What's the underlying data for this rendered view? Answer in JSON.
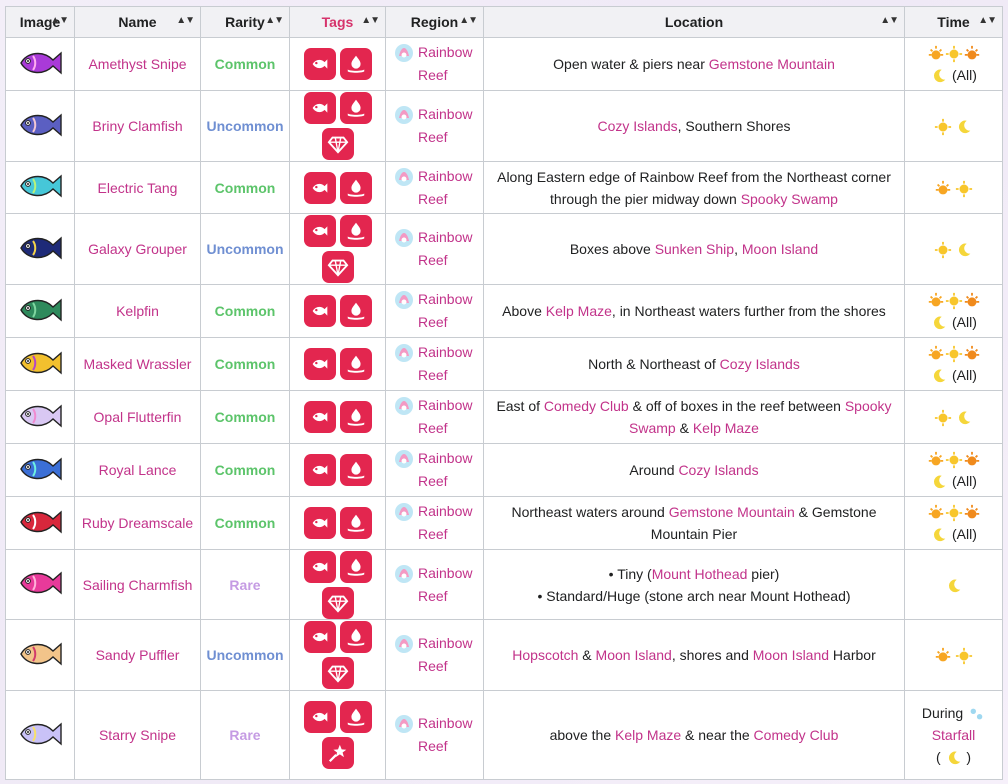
{
  "headers": {
    "image": "Image",
    "name": "Name",
    "rarity": "Rarity",
    "tags": "Tags",
    "region": "Region",
    "location": "Location",
    "time": "Time"
  },
  "rows": [
    {
      "name": "Amethyst Snipe",
      "rarity": "Common",
      "rarity_class": "common",
      "tags": [
        "fish-tag",
        "water-tag"
      ],
      "region": "Rainbow Reef",
      "location_parts": [
        {
          "t": "Open water & piers near "
        },
        {
          "t": "Gemstone Mountain",
          "link": true
        }
      ],
      "time_icons": [
        "sunrise",
        "sun",
        "sunset",
        "moon"
      ],
      "time_text": "(All)",
      "fish_color": "#a93ad8",
      "fish_accent": "#ffb0f0"
    },
    {
      "name": "Briny Clamfish",
      "rarity": "Uncommon",
      "rarity_class": "uncommon",
      "tags": [
        "fish-tag",
        "water-tag",
        "gem-tag"
      ],
      "region": "Rainbow Reef",
      "location_parts": [
        {
          "t": "Cozy Islands",
          "link": true
        },
        {
          "t": ", Southern Shores"
        }
      ],
      "time_icons": [
        "sun",
        "moon"
      ],
      "time_text": "",
      "fish_color": "#5b5fc2",
      "fish_accent": "#f2c7d4"
    },
    {
      "name": "Electric Tang",
      "rarity": "Common",
      "rarity_class": "common",
      "tags": [
        "fish-tag",
        "water-tag"
      ],
      "region": "Rainbow Reef",
      "location_parts": [
        {
          "t": "Along Eastern edge of Rainbow Reef from the Northeast corner through the pier midway down "
        },
        {
          "t": "Spooky Swamp",
          "link": true
        }
      ],
      "time_icons": [
        "sunrise",
        "sun"
      ],
      "time_text": "",
      "fish_color": "#46c7d8",
      "fish_accent": "#b8f27a"
    },
    {
      "name": "Galaxy Grouper",
      "rarity": "Uncommon",
      "rarity_class": "uncommon",
      "tags": [
        "fish-tag",
        "water-tag",
        "gem-tag"
      ],
      "region": "Rainbow Reef",
      "location_parts": [
        {
          "t": "Boxes above "
        },
        {
          "t": "Sunken Ship",
          "link": true
        },
        {
          "t": ", "
        },
        {
          "t": "Moon Island",
          "link": true
        }
      ],
      "time_icons": [
        "sun",
        "moon"
      ],
      "time_text": "",
      "fish_color": "#1e2a78",
      "fish_accent": "#f5d34a"
    },
    {
      "name": "Kelpfin",
      "rarity": "Common",
      "rarity_class": "common",
      "tags": [
        "fish-tag",
        "water-tag"
      ],
      "region": "Rainbow Reef",
      "location_parts": [
        {
          "t": "Above "
        },
        {
          "t": "Kelp Maze",
          "link": true
        },
        {
          "t": ", in Northeast waters further from the shores"
        }
      ],
      "time_icons": [
        "sunrise",
        "sun",
        "sunset",
        "moon"
      ],
      "time_text": "(All)",
      "fish_color": "#2e8a5c",
      "fish_accent": "#7fd6a0"
    },
    {
      "name": "Masked Wrassler",
      "rarity": "Common",
      "rarity_class": "common",
      "tags": [
        "fish-tag",
        "water-tag"
      ],
      "region": "Rainbow Reef",
      "location_parts": [
        {
          "t": "North & Northeast of "
        },
        {
          "t": "Cozy Islands",
          "link": true
        }
      ],
      "time_icons": [
        "sunrise",
        "sun",
        "sunset",
        "moon"
      ],
      "time_text": "(All)",
      "fish_color": "#f2c02e",
      "fish_accent": "#b545c9"
    },
    {
      "name": "Opal Flutterfin",
      "rarity": "Common",
      "rarity_class": "common",
      "tags": [
        "fish-tag",
        "water-tag"
      ],
      "region": "Rainbow Reef",
      "location_parts": [
        {
          "t": "East of "
        },
        {
          "t": "Comedy Club",
          "link": true
        },
        {
          "t": " & off of boxes in the reef between "
        },
        {
          "t": "Spooky Swamp",
          "link": true
        },
        {
          "t": " & "
        },
        {
          "t": "Kelp Maze",
          "link": true
        }
      ],
      "time_icons": [
        "sun",
        "moon"
      ],
      "time_text": "",
      "fish_color": "#d9c8f3",
      "fish_accent": "#f08ad0"
    },
    {
      "name": "Royal Lance",
      "rarity": "Common",
      "rarity_class": "common",
      "tags": [
        "fish-tag",
        "water-tag"
      ],
      "region": "Rainbow Reef",
      "location_parts": [
        {
          "t": "Around "
        },
        {
          "t": "Cozy Islands",
          "link": true
        }
      ],
      "time_icons": [
        "sunrise",
        "sun",
        "sunset",
        "moon"
      ],
      "time_text": "(All)",
      "fish_color": "#3b6fd6",
      "fish_accent": "#6ef0e0"
    },
    {
      "name": "Ruby Dreamscale",
      "rarity": "Common",
      "rarity_class": "common",
      "tags": [
        "fish-tag",
        "water-tag"
      ],
      "region": "Rainbow Reef",
      "location_parts": [
        {
          "t": "Northeast waters around "
        },
        {
          "t": "Gemstone Mountain",
          "link": true
        },
        {
          "t": " & Gemstone Mountain Pier"
        }
      ],
      "time_icons": [
        "sunrise",
        "sun",
        "sunset",
        "moon"
      ],
      "time_text": "(All)",
      "fish_color": "#d8273c",
      "fish_accent": "#ffffff"
    },
    {
      "name": "Sailing Charmfish",
      "rarity": "Rare",
      "rarity_class": "rare",
      "tags": [
        "fish-tag",
        "water-tag",
        "gem-tag"
      ],
      "region": "Rainbow Reef",
      "location_lines": [
        [
          {
            "t": "• Tiny ("
          },
          {
            "t": "Mount Hothead",
            "link": true
          },
          {
            "t": " pier)"
          }
        ],
        [
          {
            "t": "• Standard/Huge (stone arch near Mount Hothead)"
          }
        ]
      ],
      "time_icons": [
        "moon"
      ],
      "time_text": "",
      "fish_color": "#e83a9a",
      "fish_accent": "#ffb3d9"
    },
    {
      "name": "Sandy Puffler",
      "rarity": "Uncommon",
      "rarity_class": "uncommon",
      "tags": [
        "fish-tag",
        "water-tag",
        "gem-tag"
      ],
      "region": "Rainbow Reef",
      "location_parts": [
        {
          "t": "Hopscotch",
          "link": true
        },
        {
          "t": " & "
        },
        {
          "t": "Moon Island",
          "link": true
        },
        {
          "t": ", shores and "
        },
        {
          "t": "Moon Island",
          "link": true
        },
        {
          "t": " Harbor"
        }
      ],
      "time_icons": [
        "sunrise",
        "sun"
      ],
      "time_text": "",
      "fish_color": "#f2c48a",
      "fish_accent": "#d23b6b"
    },
    {
      "name": "Starry Snipe",
      "rarity": "Rare",
      "rarity_class": "rare",
      "tags": [
        "fish-tag",
        "water-tag",
        "star-tag"
      ],
      "region": "Rainbow Reef",
      "location_parts": [
        {
          "t": "above the "
        },
        {
          "t": "Kelp Maze",
          "link": true
        },
        {
          "t": " & near the "
        },
        {
          "t": "Comedy Club",
          "link": true
        }
      ],
      "time_icons": [],
      "time_text": "",
      "time_special": {
        "during": "During",
        "event": "Starfall",
        "paren_open": "(",
        "paren_close": ")"
      },
      "fish_color": "#c9c2f7",
      "fish_accent": "#f7e06a"
    }
  ],
  "colors": {
    "tag_bg": "#e3264f",
    "link": "#c2338a",
    "common": "#5cc46a",
    "uncommon": "#6f8fd2",
    "rare": "#c59be3"
  }
}
